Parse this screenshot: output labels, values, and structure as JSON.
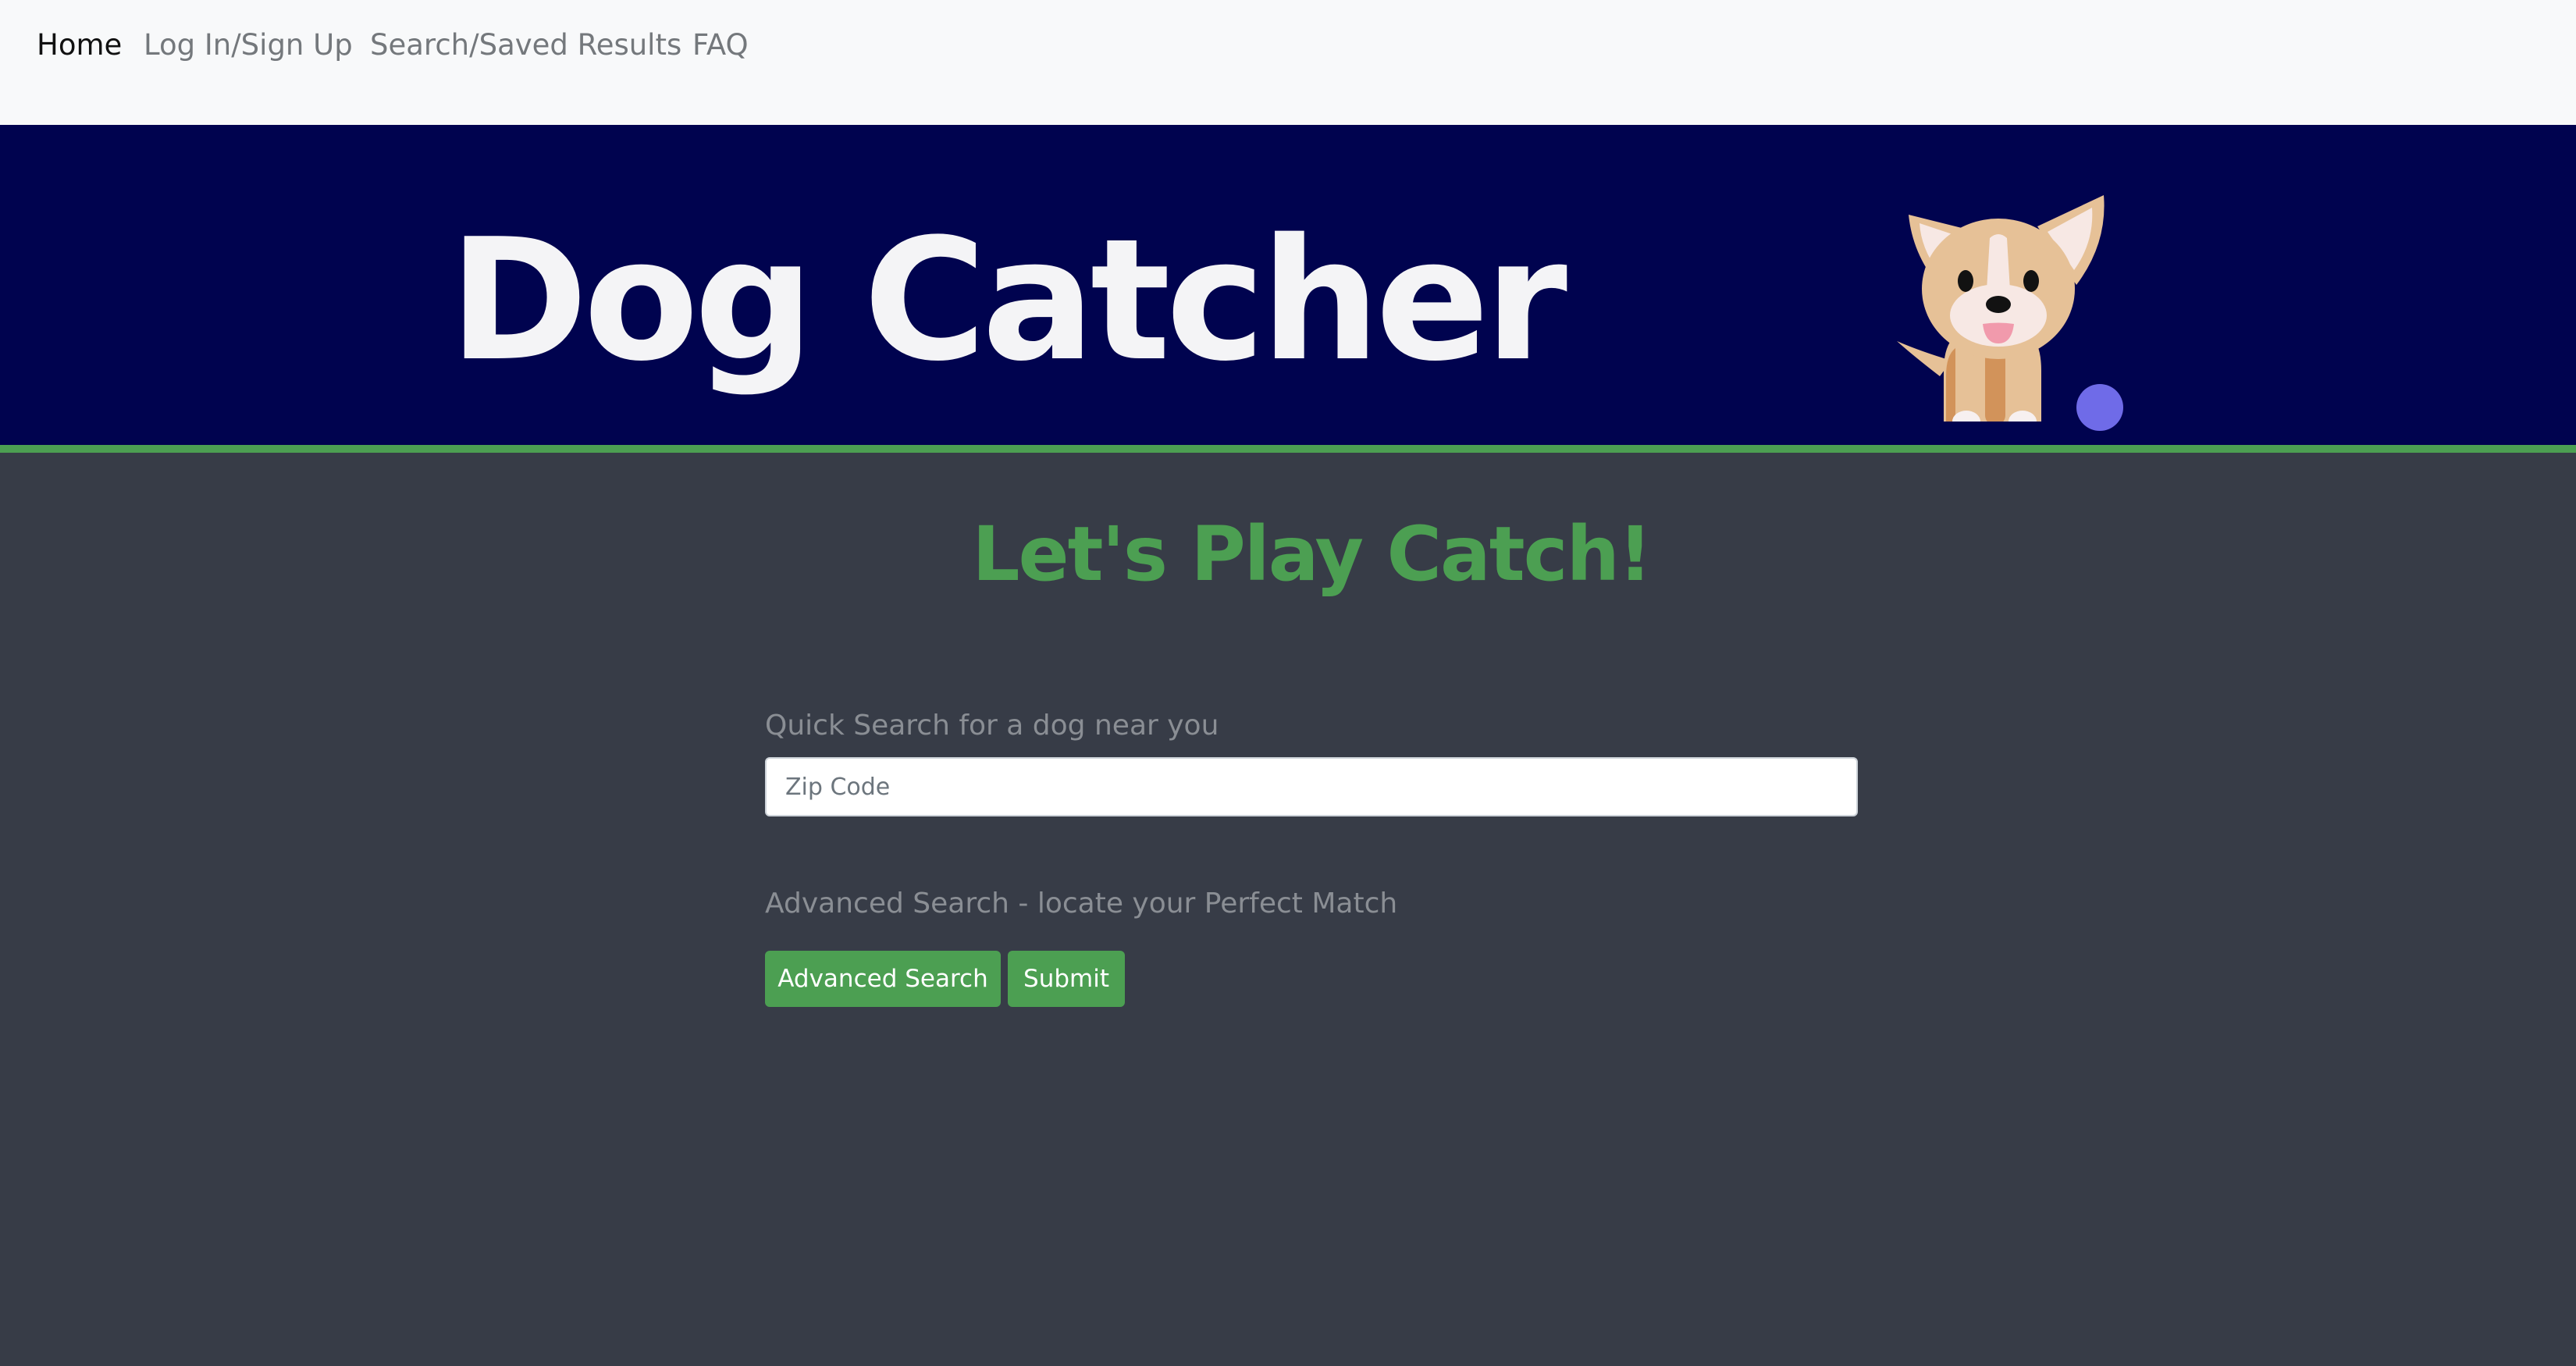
{
  "nav": {
    "items": [
      {
        "label": "Home",
        "active": true
      },
      {
        "label": "Log In/Sign Up",
        "active": false
      },
      {
        "label": "Search/Saved Results",
        "active": false
      },
      {
        "label": "FAQ",
        "active": false
      }
    ]
  },
  "banner": {
    "title": "Dog Catcher",
    "mascot_icon": "dog-icon",
    "ball_icon": "ball-icon"
  },
  "main": {
    "headline": "Let's Play Catch!",
    "quick_search_label": "Quick Search for a dog near you",
    "zip_placeholder": "Zip Code",
    "zip_value": "",
    "advanced_label": "Advanced Search - locate your Perfect Match",
    "advanced_button": "Advanced Search",
    "submit_button": "Submit"
  },
  "colors": {
    "navbar_bg": "#f8f9fa",
    "banner_bg": "#00034f",
    "accent_green": "#4c9f52",
    "page_bg": "#373c47",
    "ball": "#6f6be8"
  }
}
